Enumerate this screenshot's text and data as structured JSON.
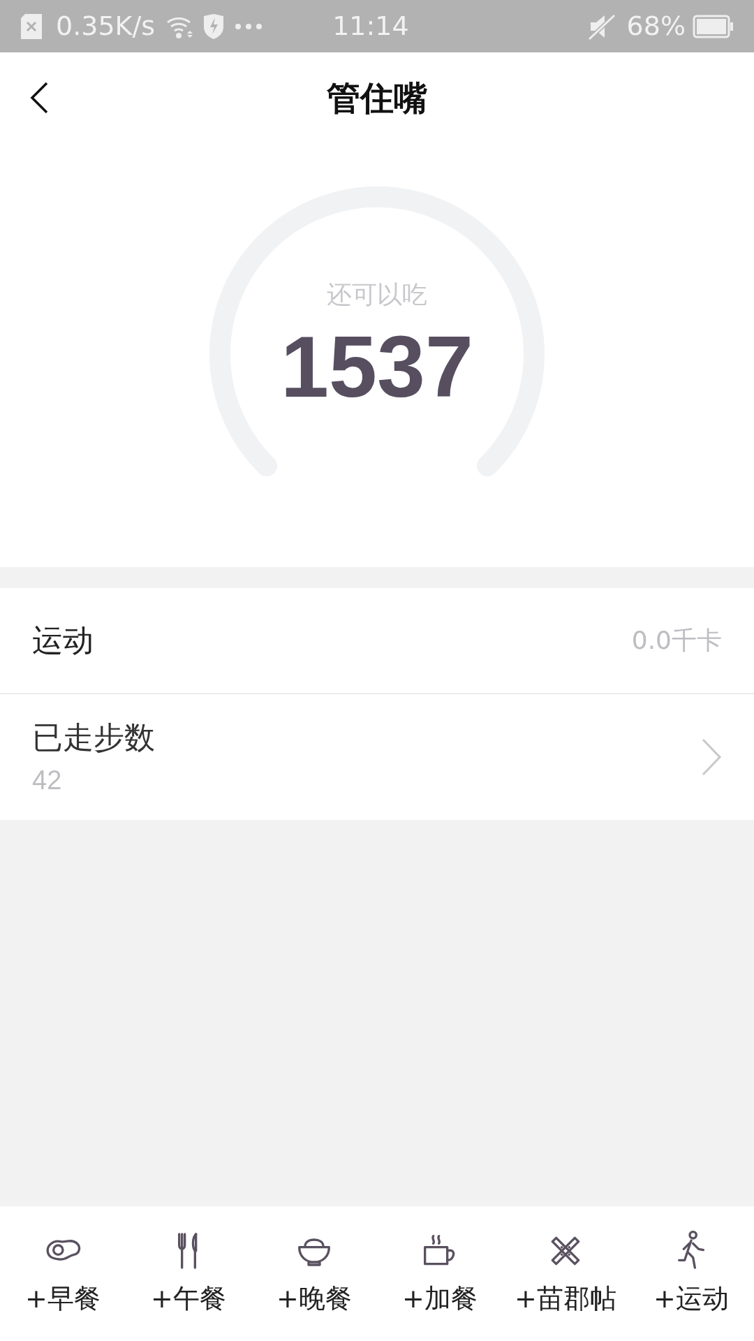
{
  "status_bar": {
    "speed": "0.35K/s",
    "time": "11:14",
    "battery": "68%"
  },
  "header": {
    "title": "管住嘴"
  },
  "gauge": {
    "caption": "还可以吃",
    "value": "1537"
  },
  "rows": [
    {
      "kind": "value",
      "label": "运动",
      "value": "0.0千卡"
    },
    {
      "kind": "link",
      "label": "已走步数",
      "value": "42"
    }
  ],
  "bottom_actions": [
    {
      "kind": "egg",
      "label": "+早餐"
    },
    {
      "kind": "cutlery",
      "label": "+午餐"
    },
    {
      "kind": "bowl",
      "label": "+晚餐"
    },
    {
      "kind": "cup",
      "label": "+加餐"
    },
    {
      "kind": "bandage",
      "label": "+苗郡帖"
    },
    {
      "kind": "runner",
      "label": "+运动"
    }
  ]
}
